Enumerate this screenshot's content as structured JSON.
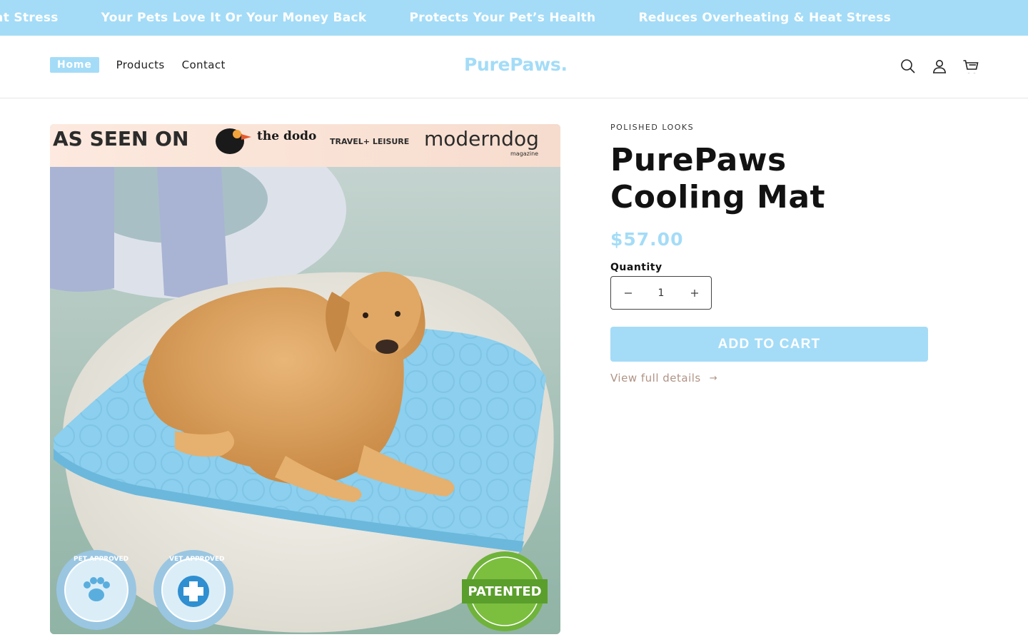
{
  "announcement": {
    "items": [
      "Reduces Overheating & Heat Stress",
      "Your Pets Love It Or Your Money Back",
      "Protects Your Pet’s Health",
      "Reduces Overheating & Heat Stress"
    ]
  },
  "header": {
    "nav": [
      "Home",
      "Products",
      "Contact"
    ],
    "active_nav": "Home",
    "logo": "PurePaws.",
    "icons": [
      "search-icon",
      "account-icon",
      "cart-icon"
    ]
  },
  "product_image": {
    "banner_text": "AS SEEN ON",
    "press_logos": [
      "the dodo",
      "TRAVEL+ LEISURE",
      "moderndog"
    ],
    "press_sublabel": "magazine",
    "badges": [
      {
        "ring_text": "PET APPROVED",
        "icon": "paw-icon"
      },
      {
        "ring_text": "VET APPROVED",
        "icon": "medical-cross-icon"
      },
      {
        "text": "PATENTED"
      }
    ]
  },
  "product": {
    "vendor": "POLISHED LOOKS",
    "title": "PurePaws Cooling Mat",
    "price": "$57.00",
    "quantity_label": "Quantity",
    "quantity_value": "1",
    "add_to_cart": "ADD TO CART",
    "details_link": "View full details",
    "details_arrow": "→"
  },
  "colors": {
    "accent": "#a4dcf7",
    "link": "#b09385",
    "text": "#121212"
  }
}
